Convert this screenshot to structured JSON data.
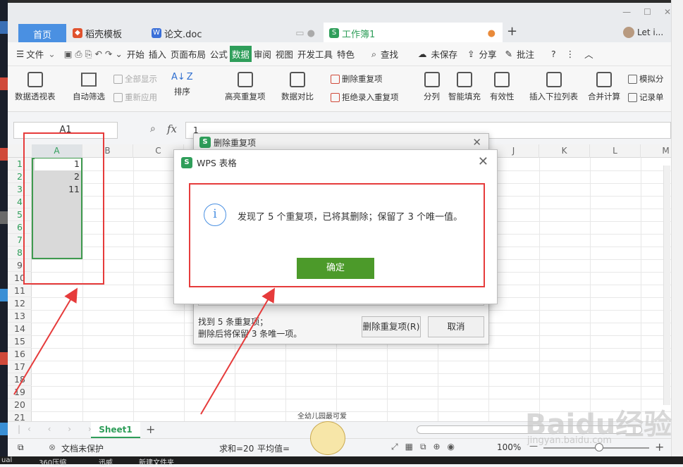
{
  "tabs": {
    "home": "首页",
    "template": "稻壳模板",
    "doc": "论文.doc",
    "book": "工作簿1"
  },
  "user": "Let i...",
  "menu": {
    "file": "文件",
    "items": [
      "开始",
      "插入",
      "页面布局",
      "公式",
      "数据",
      "审阅",
      "视图",
      "开发工具",
      "特色"
    ],
    "search": "查找",
    "unsaved": "未保存",
    "share": "分享",
    "comment": "批注"
  },
  "ribbon": {
    "pivot": "数据透视表",
    "autofilter": "自动筛选",
    "show_all": "全部显示",
    "reapply": "重新应用",
    "sort": "排序",
    "highlight_dup": "高亮重复项",
    "compare": "数据对比",
    "delete_dup": "删除重复项",
    "reject_dup": "拒绝录入重复项",
    "split": "分列",
    "smart_fill": "智能填充",
    "validity": "有效性",
    "dropdown": "插入下拉列表",
    "consolidate": "合并计算",
    "simulate": "模拟分",
    "records": "记录单"
  },
  "formula": {
    "namebox": "A1",
    "fx": "fx",
    "value": "1"
  },
  "columns": [
    "A",
    "B",
    "C",
    "D",
    "E",
    "F",
    "G",
    "H",
    "I",
    "J",
    "K",
    "L",
    "M"
  ],
  "rows": [
    "1",
    "2",
    "3",
    "4",
    "5",
    "6",
    "7",
    "8",
    "9",
    "10",
    "11",
    "12",
    "13",
    "14",
    "15",
    "16",
    "17",
    "18",
    "19",
    "20",
    "21"
  ],
  "cells": {
    "a1": "1",
    "a2": "2",
    "a3": "11"
  },
  "dialog_back": {
    "title": "删除重复项",
    "found": "找到 5 条重复项；",
    "after": "删除后将保留 3 条唯一项。",
    "delete_btn": "删除重复项(R)",
    "cancel_btn": "取消"
  },
  "dialog": {
    "title": "WPS 表格",
    "message": "发现了 5 个重复项，已将其删除；保留了 3 个唯一值。",
    "ok": "确定"
  },
  "sheet_tab": "Sheet1",
  "status": {
    "protect": "文档未保护",
    "sum": "求和=20",
    "avg": "平均值=",
    "zoom": "100%"
  },
  "taskbar": [
    "ual",
    "360压缩",
    "迅威",
    "新建文件夹"
  ],
  "sticker": "全幼儿园最可爱",
  "watermark": "Baidu经验",
  "watermark_url": "jingyan.baidu.com",
  "colors": {
    "accent": "#2f9e5a",
    "ok": "#4c9a2a",
    "annot": "#e63b3b",
    "tab_home": "#4a90e2"
  }
}
